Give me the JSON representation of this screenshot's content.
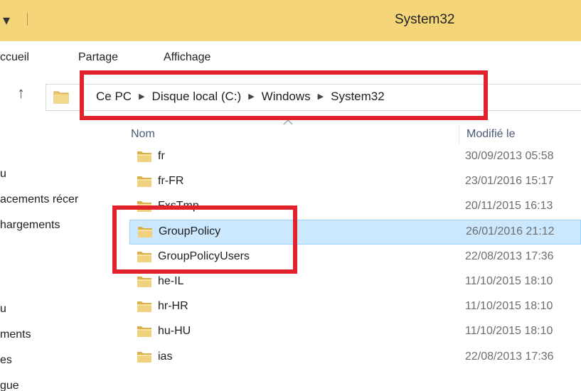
{
  "window": {
    "title": "System32",
    "qat_glyph": "▾"
  },
  "ribbon": {
    "tabs": [
      "ccueil",
      "Partage",
      "Affichage"
    ]
  },
  "address_bar": {
    "breadcrumbs": [
      "Ce PC",
      "Disque local (C:)",
      "Windows",
      "System32"
    ]
  },
  "nav_pane": {
    "items": [
      "u",
      "acements récer",
      "hargements",
      "u",
      "ments",
      "es",
      "gue"
    ]
  },
  "file_list": {
    "columns": {
      "name": "Nom",
      "modified": "Modifié le"
    },
    "rows": [
      {
        "name": "fr",
        "modified": "30/09/2013 05:58",
        "selected": false
      },
      {
        "name": "fr-FR",
        "modified": "23/01/2016 15:17",
        "selected": false
      },
      {
        "name": "FxsTmp",
        "modified": "20/11/2015 16:13",
        "selected": false
      },
      {
        "name": "GroupPolicy",
        "modified": "26/01/2016 21:12",
        "selected": true
      },
      {
        "name": "GroupPolicyUsers",
        "modified": "22/08/2013 17:36",
        "selected": false
      },
      {
        "name": "he-IL",
        "modified": "11/10/2015 18:10",
        "selected": false
      },
      {
        "name": "hr-HR",
        "modified": "11/10/2015 18:10",
        "selected": false
      },
      {
        "name": "hu-HU",
        "modified": "11/10/2015 18:10",
        "selected": false
      },
      {
        "name": "ias",
        "modified": "22/08/2013 17:36",
        "selected": false
      }
    ]
  },
  "colors": {
    "titlebar": "#f5d57a",
    "selection": "#cce8ff",
    "highlight_box": "#e0232b",
    "folder_icon": "#e8c86a"
  },
  "icons": {
    "folder": "folder-icon",
    "up": "up-arrow-icon",
    "breadcrumb_separator": "chevron-right-icon"
  }
}
